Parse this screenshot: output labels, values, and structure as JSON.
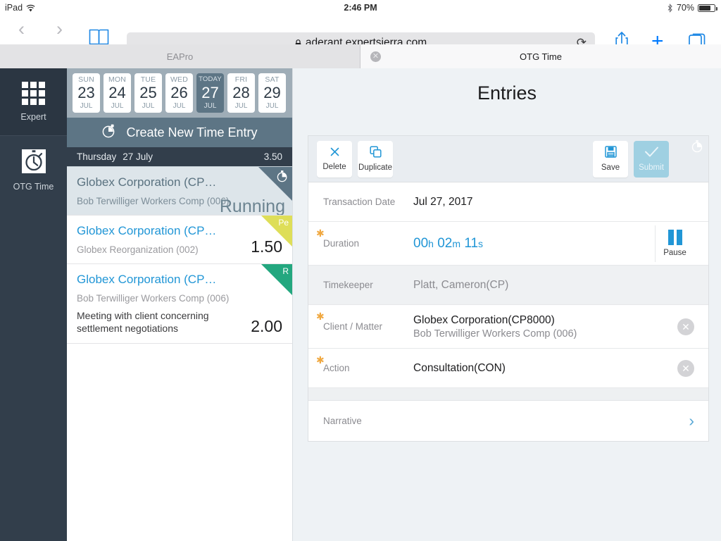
{
  "status_bar": {
    "device": "iPad",
    "wifi_icon": "wifi-icon",
    "time": "2:46 PM",
    "bluetooth_icon": "bluetooth-icon",
    "battery_percent": "70%",
    "battery_level": 70,
    "battery_icon": "battery-icon"
  },
  "browser": {
    "back_icon": "chevron-left-icon",
    "forward_icon": "chevron-right-icon",
    "bookmarks_icon": "book-icon",
    "lock_icon": "lock-icon",
    "url": "aderant.expertsierra.com",
    "reload_icon": "reload-icon",
    "share_icon": "share-icon",
    "new_tab_icon": "plus-icon",
    "tabs_icon": "tabs-icon",
    "tabs": [
      {
        "label": "EAPro",
        "active": false,
        "close_icon": "close-icon"
      },
      {
        "label": "OTG Time",
        "active": true,
        "close_icon": "close-icon"
      }
    ]
  },
  "rail": {
    "items": [
      {
        "label": "Expert",
        "icon": "grid-icon",
        "selected": true
      },
      {
        "label": "OTG Time",
        "icon": "stopwatch-icon",
        "selected": false
      }
    ]
  },
  "date_strip": {
    "days": [
      {
        "dow": "SUN",
        "num": "23",
        "month": "JUL",
        "today": false
      },
      {
        "dow": "MON",
        "num": "24",
        "month": "JUL",
        "today": false
      },
      {
        "dow": "TUE",
        "num": "25",
        "month": "JUL",
        "today": false
      },
      {
        "dow": "WED",
        "num": "26",
        "month": "JUL",
        "today": false
      },
      {
        "dow": "TODAY",
        "num": "27",
        "month": "JUL",
        "today": true
      },
      {
        "dow": "FRI",
        "num": "28",
        "month": "JUL",
        "today": false
      },
      {
        "dow": "SAT",
        "num": "29",
        "month": "JUL",
        "today": false
      }
    ]
  },
  "create_bar": {
    "label": "Create New Time Entry",
    "icon": "stopwatch-icon"
  },
  "day_header": {
    "weekday": "Thursday",
    "date": "27 July",
    "total": "3.50"
  },
  "entries": [
    {
      "client": "Globex Corporation (CP…",
      "matter": "Bob Terwilliger Workers Comp (006)",
      "narrative": "",
      "amount": "",
      "status_text": "Running",
      "ribbon_kind": "slate",
      "ribbon_label": "",
      "ribbon_icon": "stopwatch-icon",
      "selected": true
    },
    {
      "client": "Globex Corporation (CP…",
      "matter": "Globex Reorganization (002)",
      "narrative": "",
      "amount": "1.50",
      "status_text": "",
      "ribbon_kind": "yellow",
      "ribbon_label": "Pe",
      "ribbon_icon": "",
      "selected": false
    },
    {
      "client": "Globex Corporation (CP…",
      "matter": "Bob Terwilliger Workers Comp (006)",
      "narrative": "Meeting with client concerning settlement negotiations",
      "amount": "2.00",
      "status_text": "",
      "ribbon_kind": "green",
      "ribbon_label": "R",
      "ribbon_icon": "",
      "selected": false
    }
  ],
  "detail": {
    "title": "Entries",
    "ribbon_icon": "stopwatch-icon",
    "toolbar": {
      "delete_label": "Delete",
      "delete_icon": "close-icon",
      "duplicate_label": "Duplicate",
      "duplicate_icon": "copy-icon",
      "save_label": "Save",
      "save_icon": "save-icon",
      "submit_label": "Submit",
      "submit_icon": "check-icon"
    },
    "rows": {
      "transaction_date": {
        "label": "Transaction Date",
        "value": "Jul 27, 2017"
      },
      "duration": {
        "label": "Duration",
        "hours": "00",
        "hours_unit": "h",
        "minutes": "02",
        "minutes_unit": "m",
        "seconds": "11",
        "seconds_unit": "s",
        "pause_label": "Pause",
        "pause_icon": "pause-icon",
        "required": true
      },
      "timekeeper": {
        "label": "Timekeeper",
        "value": "Platt, Cameron(CP)"
      },
      "client_matter": {
        "label": "Client / Matter",
        "value": "Globex Corporation(CP8000)",
        "sub": "Bob Terwilliger Workers Comp (006)",
        "clear_icon": "clear-icon",
        "required": true
      },
      "action": {
        "label": "Action",
        "value": "Consultation(CON)",
        "clear_icon": "clear-icon",
        "required": true
      },
      "narrative": {
        "label": "Narrative",
        "value": "",
        "chevron_icon": "chevron-right-icon"
      }
    }
  },
  "colors": {
    "accent_blue": "#2196d6",
    "slate": "#5d7585",
    "dark_slate": "#323e4b",
    "pending_yellow": "#dede58",
    "released_green": "#23a77f",
    "required_star": "#f0a840"
  }
}
